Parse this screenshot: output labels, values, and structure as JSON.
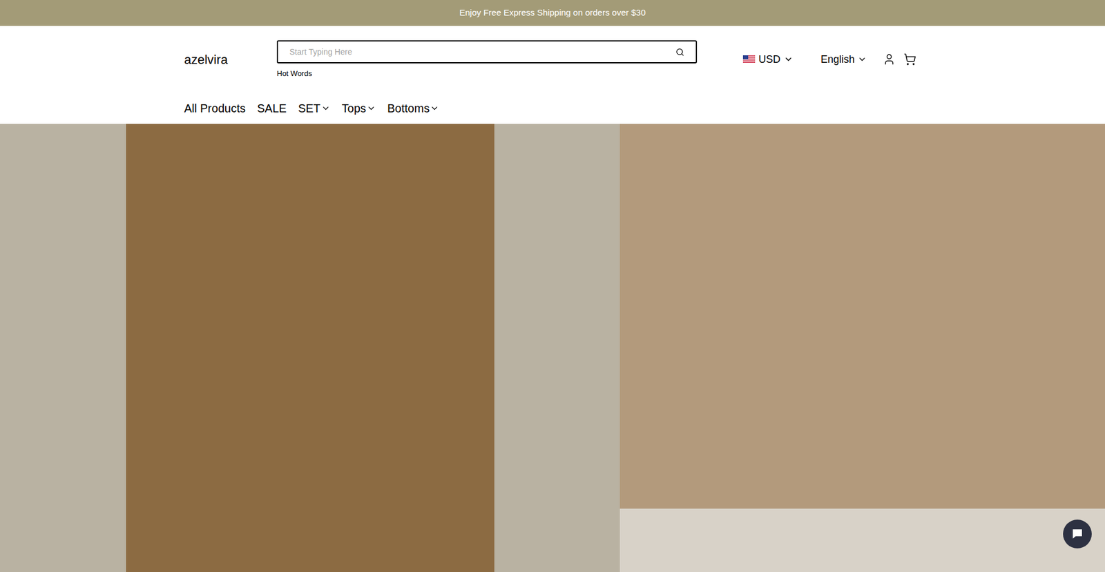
{
  "announcement": {
    "text": "Enjoy Free Express Shipping on orders over $30"
  },
  "header": {
    "logo": "azelvira",
    "search": {
      "placeholder": "Start Typing Here",
      "hint": "Hot Words"
    },
    "currency": "USD",
    "language": "English"
  },
  "nav": [
    {
      "label": "All Products",
      "has_dropdown": false
    },
    {
      "label": "SALE",
      "has_dropdown": false
    },
    {
      "label": "SET",
      "has_dropdown": true
    },
    {
      "label": "Tops",
      "has_dropdown": true
    },
    {
      "label": "Bottoms",
      "has_dropdown": true
    }
  ]
}
